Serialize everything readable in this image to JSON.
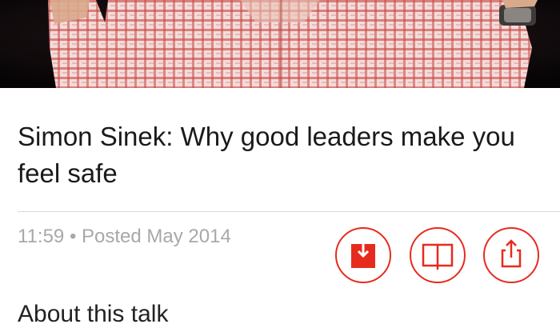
{
  "talk": {
    "title": "Simon Sinek: Why good leaders make you feel safe",
    "duration": "11:59",
    "separator": "•",
    "posted": "Posted May 2014"
  },
  "actions": [
    {
      "name": "download",
      "icon": "download-icon"
    },
    {
      "name": "reading-list",
      "icon": "book-icon"
    },
    {
      "name": "share",
      "icon": "share-icon"
    }
  ],
  "section": {
    "about_label": "About this talk"
  },
  "colors": {
    "accent": "#e62b1e",
    "meta_text": "#a8a8a8",
    "title_text": "#1a1a1a",
    "hero_background": "#0c0a0b",
    "shirt_red": "#c44a4a",
    "shirt_light": "#f0d6d4"
  }
}
